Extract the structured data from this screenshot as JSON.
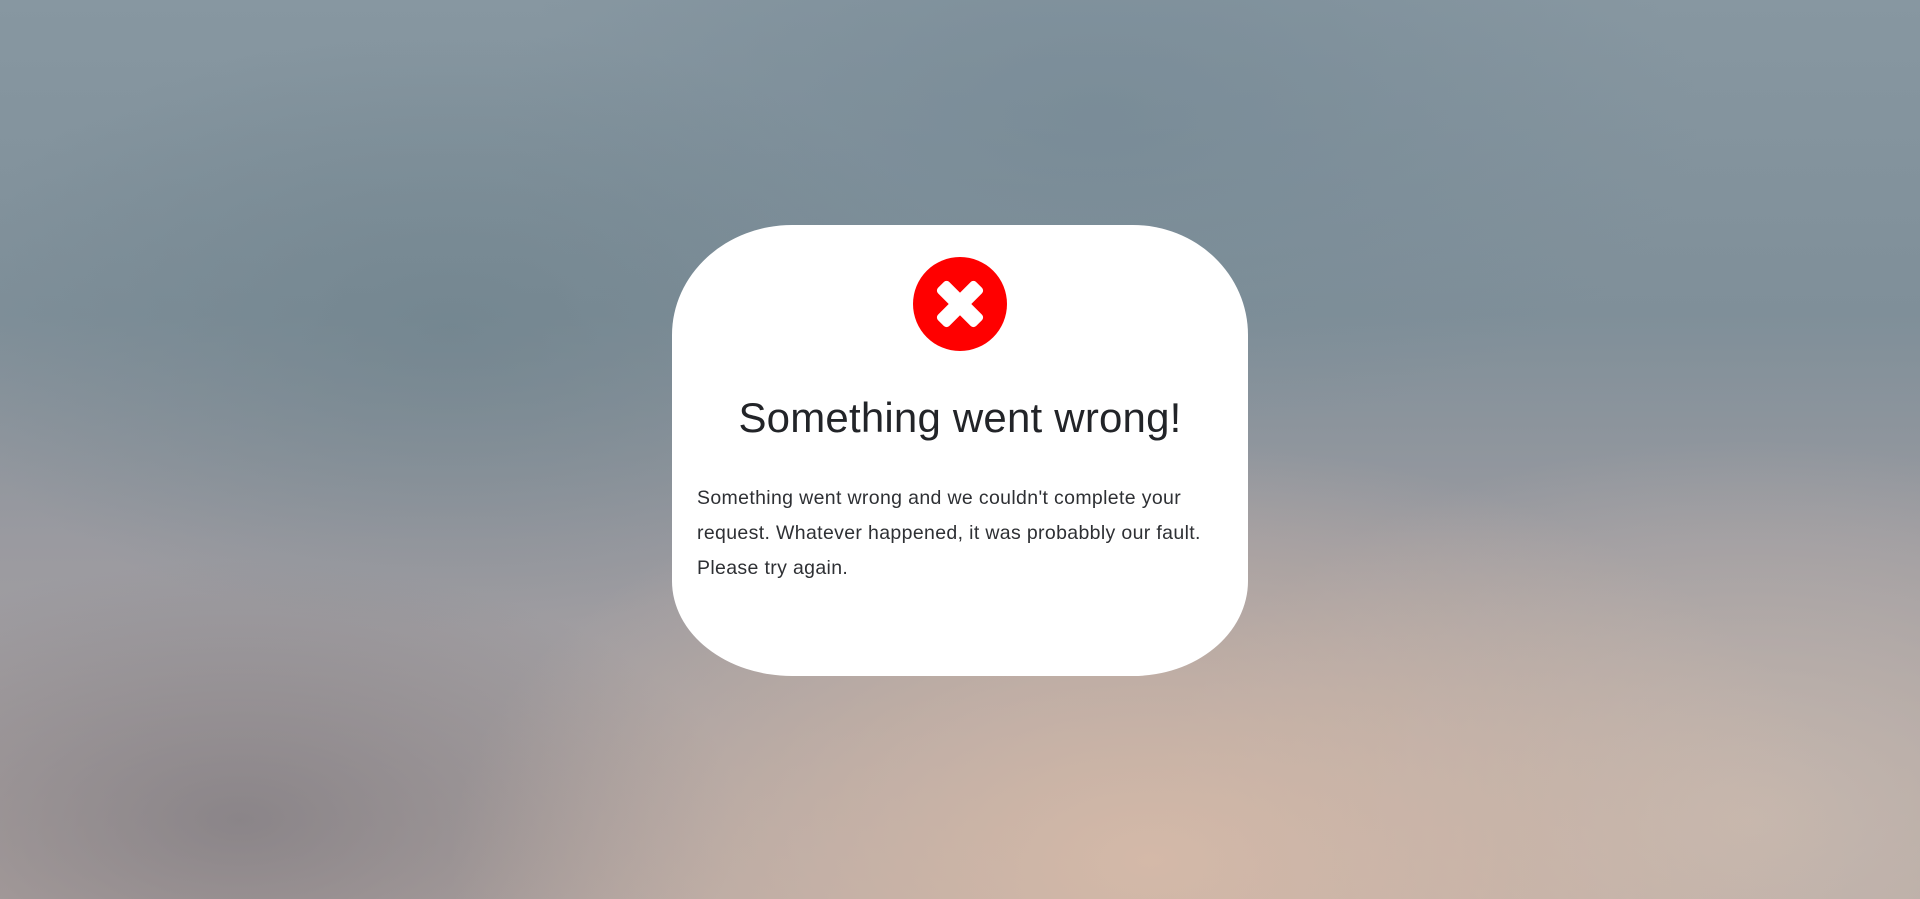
{
  "dialog": {
    "icon": "error-x-circle-icon",
    "icon_color": "#ff0000",
    "title": "Something went wrong!",
    "message": "Something went wrong and we couldn't complete your request. Whatever happened, it was probabbly our fault. Please try again."
  }
}
